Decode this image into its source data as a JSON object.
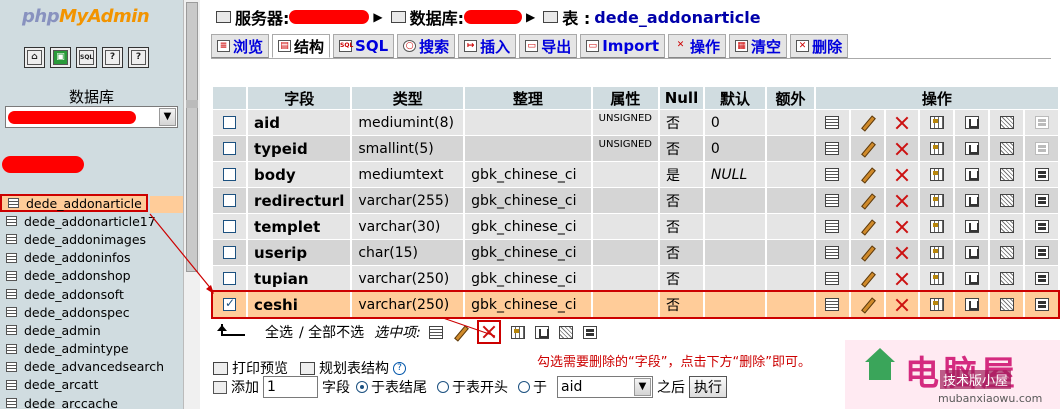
{
  "left": {
    "logo_php": "php",
    "logo_myadmin": "MyAdmin",
    "quick_icons": [
      "home-icon",
      "query-window-icon",
      "sql-icon",
      "docs-icon",
      "help-icon"
    ],
    "db_label": "数据库",
    "tables": [
      "dede_addonarticle",
      "dede_addonarticle17",
      "dede_addonimages",
      "dede_addoninfos",
      "dede_addonshop",
      "dede_addonsoft",
      "dede_addonspec",
      "dede_admin",
      "dede_admintype",
      "dede_advancedsearch",
      "dede_arcatt",
      "dede_arccache"
    ],
    "active_table_index": 0
  },
  "breadcrumb": {
    "server_label": "服务器:",
    "database_label": "数据库:",
    "table_label": "表 :",
    "table_name": "dede_addonarticle"
  },
  "tabs": [
    {
      "label": "浏览",
      "icon": "browse-icon"
    },
    {
      "label": "结构",
      "icon": "structure-icon",
      "current": true
    },
    {
      "label": "SQL",
      "icon": "sql-icon"
    },
    {
      "label": "搜索",
      "icon": "search-icon"
    },
    {
      "label": "插入",
      "icon": "insert-icon"
    },
    {
      "label": "导出",
      "icon": "export-icon"
    },
    {
      "label": "Import",
      "icon": "import-icon"
    },
    {
      "label": "操作",
      "icon": "operations-icon"
    },
    {
      "label": "清空",
      "icon": "empty-icon"
    },
    {
      "label": "删除",
      "icon": "drop-icon"
    }
  ],
  "table": {
    "headers": {
      "field": "字段",
      "type": "类型",
      "collation": "整理",
      "attributes": "属性",
      "null": "Null",
      "default": "默认",
      "extra": "额外",
      "action": "操作"
    },
    "rows": [
      {
        "field": "aid",
        "type": "mediumint(8)",
        "collation": "",
        "attributes": "UNSIGNED",
        "null": "否",
        "default": "0",
        "extra": "",
        "checked": false,
        "fulltext_enabled": false
      },
      {
        "field": "typeid",
        "type": "smallint(5)",
        "collation": "",
        "attributes": "UNSIGNED",
        "null": "否",
        "default": "0",
        "extra": "",
        "checked": false,
        "fulltext_enabled": false
      },
      {
        "field": "body",
        "type": "mediumtext",
        "collation": "gbk_chinese_ci",
        "attributes": "",
        "null": "是",
        "default": "NULL",
        "extra": "",
        "checked": false,
        "fulltext_enabled": true
      },
      {
        "field": "redirecturl",
        "type": "varchar(255)",
        "collation": "gbk_chinese_ci",
        "attributes": "",
        "null": "否",
        "default": "",
        "extra": "",
        "checked": false,
        "fulltext_enabled": true
      },
      {
        "field": "templet",
        "type": "varchar(30)",
        "collation": "gbk_chinese_ci",
        "attributes": "",
        "null": "否",
        "default": "",
        "extra": "",
        "checked": false,
        "fulltext_enabled": true
      },
      {
        "field": "userip",
        "type": "char(15)",
        "collation": "gbk_chinese_ci",
        "attributes": "",
        "null": "否",
        "default": "",
        "extra": "",
        "checked": false,
        "fulltext_enabled": true
      },
      {
        "field": "tupian",
        "type": "varchar(250)",
        "collation": "gbk_chinese_ci",
        "attributes": "",
        "null": "否",
        "default": "",
        "extra": "",
        "checked": false,
        "fulltext_enabled": true
      },
      {
        "field": "ceshi",
        "type": "varchar(250)",
        "collation": "gbk_chinese_ci",
        "attributes": "",
        "null": "否",
        "default": "",
        "extra": "",
        "checked": true,
        "fulltext_enabled": true
      }
    ]
  },
  "bulk": {
    "check_all": "全选",
    "uncheck_all": "/ 全部不选",
    "with_selected": "选中项:"
  },
  "instruction": "勾选需要删除的“字段”，点击下方“删除”即可。",
  "print_view": "打印预览",
  "propose_structure": "规划表结构",
  "add_fields": {
    "add_label": "添加",
    "count": "1",
    "field_label": "字段",
    "at_end": "于表结尾",
    "at_beginning": "于表开头",
    "after_label": "于",
    "after_field": "aid",
    "after_suffix": "之后",
    "go": "执行"
  },
  "watermark": {
    "brand": "电脑屋",
    "tag": "技术版小屋",
    "url": "mubanxiaowu.com"
  },
  "colors": {
    "nav_bg": "#d0dce0",
    "row_odd": "#e5e5e5",
    "row_even": "#d5d5d5",
    "marked_row": "#ffcc99",
    "annotation_red": "#cc0000",
    "tab_link": "#0000dd"
  }
}
